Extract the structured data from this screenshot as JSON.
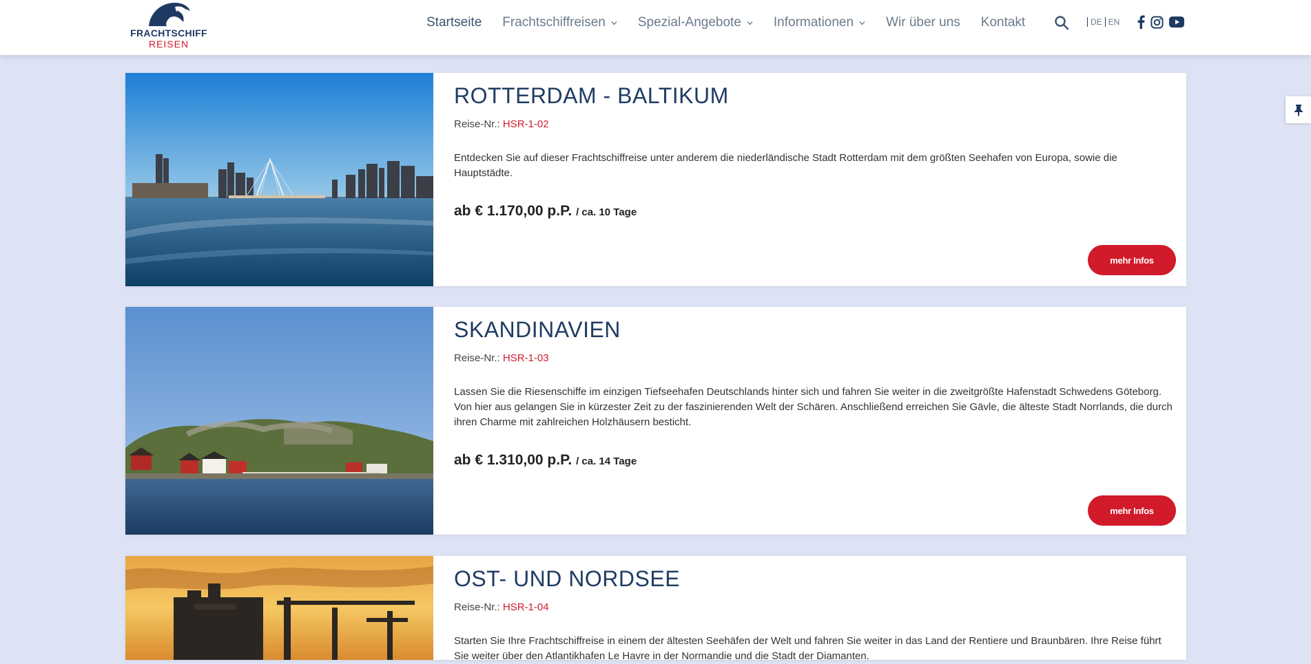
{
  "logo": {
    "line1": "FRACHTSCHIFF",
    "line2": "REISEN"
  },
  "nav": {
    "items": [
      {
        "label": "Startseite",
        "dropdown": false,
        "active": true
      },
      {
        "label": "Frachtschiffreisen",
        "dropdown": true
      },
      {
        "label": "Spezial-Angebote",
        "dropdown": true
      },
      {
        "label": "Informationen",
        "dropdown": true
      },
      {
        "label": "Wir über uns",
        "dropdown": false
      },
      {
        "label": "Kontakt",
        "dropdown": false
      }
    ],
    "search_icon": "search-icon",
    "languages": [
      "DE",
      "EN"
    ],
    "social_icons": [
      "facebook-icon",
      "instagram-icon",
      "youtube-icon"
    ]
  },
  "pin_icon": "pin-icon",
  "reise_label": "Reise-Nr.:",
  "trips": [
    {
      "title": "ROTTERDAM - BALTIKUM",
      "code": "HSR-1-02",
      "description": "Entdecken Sie auf dieser Frachtschiffreise unter anderem die niederländische Stadt Rotterdam mit dem größten Seehafen von Europa, sowie die Hauptstädte.",
      "price": "ab € 1.170,00 p.P.",
      "duration": "/ ca. 10 Tage",
      "button": "mehr Infos"
    },
    {
      "title": "SKANDINAVIEN",
      "code": "HSR-1-03",
      "description": "Lassen Sie die Riesenschiffe im einzigen Tiefseehafen Deutschlands hinter sich und fahren Sie weiter in die zweitgrößte Hafenstadt Schwedens Göteborg. Von hier aus gelangen Sie in kürzester Zeit zu der faszinierenden Welt der Schären. Anschließend erreichen Sie Gävle, die älteste Stadt Norrlands, die durch ihren Charme mit zahlreichen Holzhäusern besticht.",
      "price": "ab € 1.310,00 p.P.",
      "duration": "/ ca. 14 Tage",
      "button": "mehr Infos"
    },
    {
      "title": "OST- UND NORDSEE",
      "code": "HSR-1-04",
      "description": "Starten Sie Ihre Frachtschiffreise in einem der ältesten Seehäfen der Welt und fahren Sie weiter in das Land der Rentiere und Braunbären. Ihre Reise führt Sie weiter über den Atlantikhafen Le Havre in der Normandie und die Stadt der Diamanten.",
      "price": "",
      "duration": "",
      "button": ""
    }
  ],
  "colors": {
    "accent": "#d11a2a",
    "navy": "#1f3c63",
    "background": "#dde2f4"
  }
}
